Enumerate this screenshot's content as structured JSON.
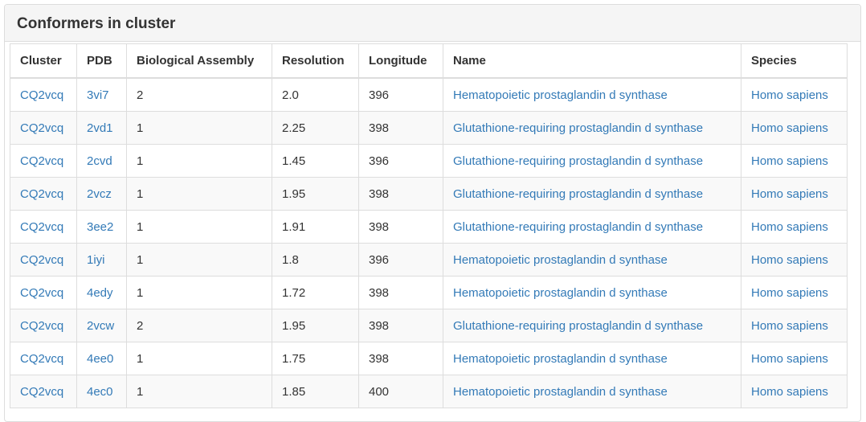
{
  "panel": {
    "title": "Conformers in cluster"
  },
  "table": {
    "headers": {
      "cluster": "Cluster",
      "pdb": "PDB",
      "assembly": "Biological Assembly",
      "resolution": "Resolution",
      "longitude": "Longitude",
      "name": "Name",
      "species": "Species"
    },
    "rows": [
      {
        "cluster": "CQ2vcq",
        "pdb": "3vi7",
        "assembly": "2",
        "resolution": "2.0",
        "longitude": "396",
        "name": "Hematopoietic prostaglandin d synthase",
        "species": "Homo sapiens"
      },
      {
        "cluster": "CQ2vcq",
        "pdb": "2vd1",
        "assembly": "1",
        "resolution": "2.25",
        "longitude": "398",
        "name": "Glutathione-requiring prostaglandin d synthase",
        "species": "Homo sapiens"
      },
      {
        "cluster": "CQ2vcq",
        "pdb": "2cvd",
        "assembly": "1",
        "resolution": "1.45",
        "longitude": "396",
        "name": "Glutathione-requiring prostaglandin d synthase",
        "species": "Homo sapiens"
      },
      {
        "cluster": "CQ2vcq",
        "pdb": "2vcz",
        "assembly": "1",
        "resolution": "1.95",
        "longitude": "398",
        "name": "Glutathione-requiring prostaglandin d synthase",
        "species": "Homo sapiens"
      },
      {
        "cluster": "CQ2vcq",
        "pdb": "3ee2",
        "assembly": "1",
        "resolution": "1.91",
        "longitude": "398",
        "name": "Glutathione-requiring prostaglandin d synthase",
        "species": "Homo sapiens"
      },
      {
        "cluster": "CQ2vcq",
        "pdb": "1iyi",
        "assembly": "1",
        "resolution": "1.8",
        "longitude": "396",
        "name": "Hematopoietic prostaglandin d synthase",
        "species": "Homo sapiens"
      },
      {
        "cluster": "CQ2vcq",
        "pdb": "4edy",
        "assembly": "1",
        "resolution": "1.72",
        "longitude": "398",
        "name": "Hematopoietic prostaglandin d synthase",
        "species": "Homo sapiens"
      },
      {
        "cluster": "CQ2vcq",
        "pdb": "2vcw",
        "assembly": "2",
        "resolution": "1.95",
        "longitude": "398",
        "name": "Glutathione-requiring prostaglandin d synthase",
        "species": "Homo sapiens"
      },
      {
        "cluster": "CQ2vcq",
        "pdb": "4ee0",
        "assembly": "1",
        "resolution": "1.75",
        "longitude": "398",
        "name": "Hematopoietic prostaglandin d synthase",
        "species": "Homo sapiens"
      },
      {
        "cluster": "CQ2vcq",
        "pdb": "4ec0",
        "assembly": "1",
        "resolution": "1.85",
        "longitude": "400",
        "name": "Hematopoietic prostaglandin d synthase",
        "species": "Homo sapiens"
      }
    ]
  },
  "colors": {
    "link": "#337ab7",
    "text": "#333333",
    "heading_bg": "#f5f5f5",
    "stripe_bg": "#f9f9f9",
    "border": "#dddddd"
  }
}
